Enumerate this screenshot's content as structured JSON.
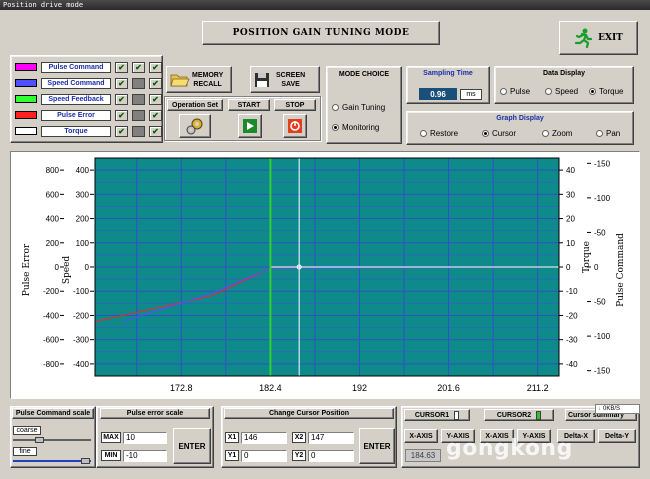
{
  "window": {
    "title": "Position drive mode"
  },
  "header": {
    "mode_title": "POSITION GAIN TUNING MODE",
    "exit_label": "EXIT"
  },
  "legend": [
    {
      "label": "Pulse Command",
      "color": "#ff00ff"
    },
    {
      "label": "Speed Command",
      "color": "#5050ff"
    },
    {
      "label": "Speed Feedback",
      "color": "#30ff30"
    },
    {
      "label": "Pulse Error",
      "color": "#ff2020"
    },
    {
      "label": "Torque",
      "color": "#ffffff"
    }
  ],
  "toolbar": {
    "memory_recall": "MEMORY\nRECALL",
    "screen_save": "SCREEN\nSAVE",
    "operation_set": "Operation Set",
    "start": "START",
    "stop": "STOP"
  },
  "mode_choice": {
    "title": "MODE CHOICE",
    "options": [
      "Gain Tuning",
      "Monitoring"
    ],
    "selected": "Monitoring"
  },
  "sampling": {
    "title": "Sampling Time",
    "value": "0.96",
    "unit": "ms"
  },
  "data_display": {
    "title": "Data Display",
    "options": [
      "Pulse",
      "Speed",
      "Torque"
    ],
    "selected": "Torque"
  },
  "graph_display": {
    "title": "Graph Display",
    "options": [
      "Restore",
      "Cursor",
      "Zoom",
      "Pan"
    ],
    "selected": "Cursor"
  },
  "chart_data": {
    "type": "line",
    "x_ticks": [
      "172.8",
      "182.4",
      "192",
      "201.6",
      "211.2"
    ],
    "axes": {
      "pulse_error": {
        "label": "Pulse Error",
        "ticks": [
          "800",
          "600",
          "400",
          "200",
          "0",
          "-200",
          "-400",
          "-600",
          "-800"
        ]
      },
      "speed": {
        "label": "Speed",
        "ticks": [
          "400",
          "300",
          "200",
          "100",
          "0",
          "-100",
          "-200",
          "-300",
          "-400"
        ]
      },
      "torque": {
        "label": "Torque",
        "ticks": [
          "40",
          "30",
          "20",
          "10",
          "0",
          "-10",
          "-20",
          "-30",
          "-40"
        ]
      },
      "pulse_command": {
        "label": "Pulse Command",
        "ticks": [
          "-150",
          "-100",
          "-50",
          "0",
          "-50",
          "-100",
          "-150"
        ]
      }
    },
    "cursors": {
      "cursor1_x": 182.4,
      "cursor2_x": 185.5
    },
    "series": [
      {
        "name": "Pulse Error",
        "color": "#ff2020",
        "x": [
          163.5,
          176,
          182.4,
          213.5
        ],
        "y": [
          -225,
          -120,
          -5,
          0
        ]
      },
      {
        "name": "Speed Command",
        "color": "#5050ff",
        "x": [
          166.5,
          176,
          182.4,
          213.5
        ],
        "y": [
          -225,
          -110,
          -5,
          0
        ]
      },
      {
        "name": "Torque",
        "color": "#ffffff",
        "x": [
          182.4,
          213.5
        ],
        "y": [
          0,
          0
        ]
      }
    ],
    "background": "#0e8a8a",
    "grid": true
  },
  "bottom": {
    "pulse_command_scale": "Pulse Command scale",
    "coarse": "coarse",
    "fine": "fine",
    "pulse_error_scale": "Pulse error scale",
    "max_label": "MAX",
    "max_value": "10",
    "min_label": "MIN",
    "min_value": "-10",
    "enter1": "ENTER",
    "change_cursor": "Change Cursor Position",
    "x1_label": "X1",
    "x1_value": "146",
    "x2_label": "X2",
    "x2_value": "147",
    "y1_label": "Y1",
    "y1_value": "0",
    "y2_label": "Y2",
    "y2_value": "0",
    "enter2": "ENTER",
    "cursor1": "CURSOR1",
    "cursor2": "CURSOR2",
    "cursor_summary": "Cursor summary",
    "xaxis1": "X-AXIS",
    "yaxis1": "Y-AXIS",
    "xaxis2": "X-AXIS",
    "yaxis2": "Y-AXIS",
    "delta_x": "Delta-X",
    "delta_y": "Delta-Y",
    "readout": "184.63",
    "speed_badge": "0KB/S"
  },
  "watermark": "gongkong"
}
